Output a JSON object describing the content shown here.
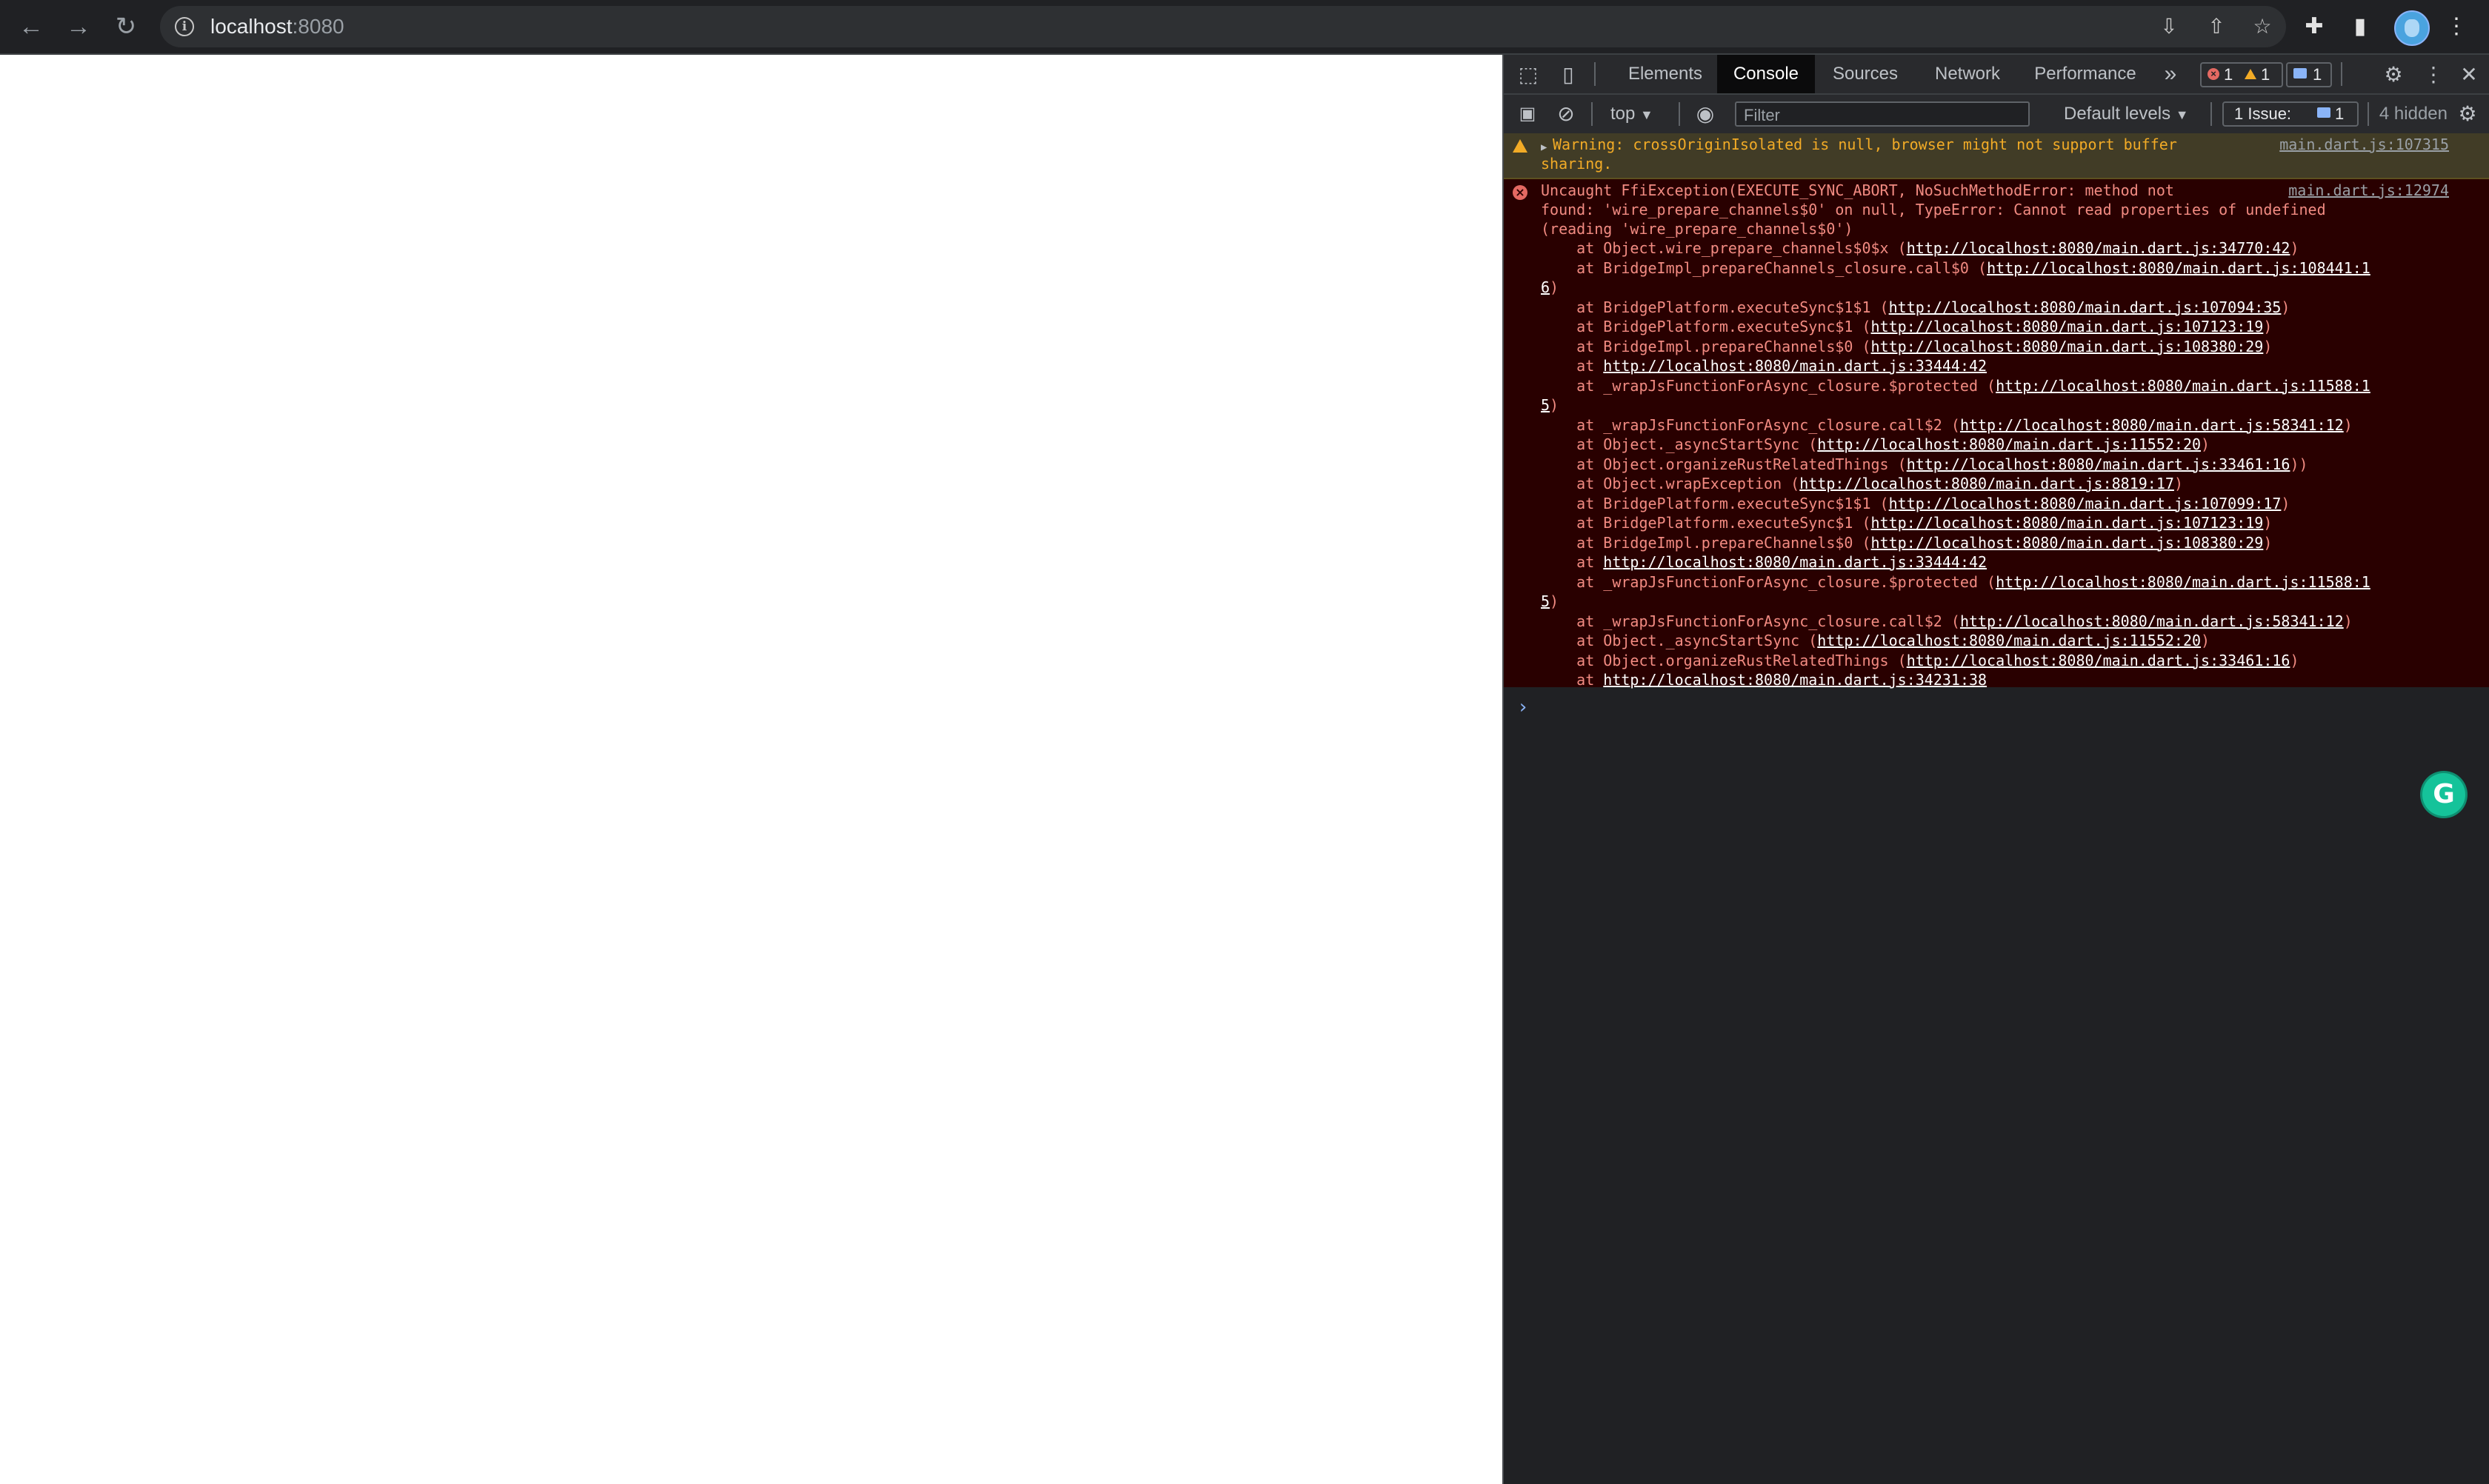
{
  "browser": {
    "url_host": "localhost",
    "url_port": ":8080"
  },
  "devtools": {
    "tabs": [
      "Elements",
      "Console",
      "Sources",
      "Network",
      "Performance"
    ],
    "active_tab": "Console",
    "more_tabs": "»",
    "errors_count": "1",
    "warnings_count": "1",
    "messages_count": "1",
    "context": "top",
    "filter_placeholder": "Filter",
    "levels": "Default levels",
    "issues_label": "1 Issue:",
    "issues_count": "1",
    "hidden": "4 hidden"
  },
  "console": {
    "warning": {
      "line1": "Warning: crossOriginIsolated is null, browser might not support buffer",
      "line2": "sharing.",
      "source": "main.dart.js:107315"
    },
    "error": {
      "line1": "Uncaught FfiException(EXECUTE_SYNC_ABORT, NoSuchMethodError: method not",
      "line2": "found: 'wire_prepare_channels$0' on null, TypeError: Cannot read properties of undefined",
      "line3": "(reading 'wire_prepare_channels$0')",
      "source": "main.dart.js:12974",
      "stack": [
        {
          "pre": "    at Object.wire_prepare_channels$0$x (",
          "link": "http://localhost:8080/main.dart.js:34770:42",
          "post": ")"
        },
        {
          "pre": "    at BridgeImpl_prepareChannels_closure.call$0 (",
          "link": "http://localhost:8080/main.dart.js:108441:1",
          "post": ""
        },
        {
          "pre": "",
          "link": "6",
          "post": ")"
        },
        {
          "pre": "    at BridgePlatform.executeSync$1$1 (",
          "link": "http://localhost:8080/main.dart.js:107094:35",
          "post": ")"
        },
        {
          "pre": "    at BridgePlatform.executeSync$1 (",
          "link": "http://localhost:8080/main.dart.js:107123:19",
          "post": ")"
        },
        {
          "pre": "    at BridgeImpl.prepareChannels$0 (",
          "link": "http://localhost:8080/main.dart.js:108380:29",
          "post": ")"
        },
        {
          "pre": "    at ",
          "link": "http://localhost:8080/main.dart.js:33444:42",
          "post": ""
        },
        {
          "pre": "    at _wrapJsFunctionForAsync_closure.$protected (",
          "link": "http://localhost:8080/main.dart.js:11588:1",
          "post": ""
        },
        {
          "pre": "",
          "link": "5",
          "post": ")"
        },
        {
          "pre": "    at _wrapJsFunctionForAsync_closure.call$2 (",
          "link": "http://localhost:8080/main.dart.js:58341:12",
          "post": ")"
        },
        {
          "pre": "    at Object._asyncStartSync (",
          "link": "http://localhost:8080/main.dart.js:11552:20",
          "post": ")"
        },
        {
          "pre": "    at Object.organizeRustRelatedThings (",
          "link": "http://localhost:8080/main.dart.js:33461:16",
          "post": "))"
        },
        {
          "pre": "    at Object.wrapException (",
          "link": "http://localhost:8080/main.dart.js:8819:17",
          "post": ")"
        },
        {
          "pre": "    at BridgePlatform.executeSync$1$1 (",
          "link": "http://localhost:8080/main.dart.js:107099:17",
          "post": ")"
        },
        {
          "pre": "    at BridgePlatform.executeSync$1 (",
          "link": "http://localhost:8080/main.dart.js:107123:19",
          "post": ")"
        },
        {
          "pre": "    at BridgeImpl.prepareChannels$0 (",
          "link": "http://localhost:8080/main.dart.js:108380:29",
          "post": ")"
        },
        {
          "pre": "    at ",
          "link": "http://localhost:8080/main.dart.js:33444:42",
          "post": ""
        },
        {
          "pre": "    at _wrapJsFunctionForAsync_closure.$protected (",
          "link": "http://localhost:8080/main.dart.js:11588:1",
          "post": ""
        },
        {
          "pre": "",
          "link": "5",
          "post": ")"
        },
        {
          "pre": "    at _wrapJsFunctionForAsync_closure.call$2 (",
          "link": "http://localhost:8080/main.dart.js:58341:12",
          "post": ")"
        },
        {
          "pre": "    at Object._asyncStartSync (",
          "link": "http://localhost:8080/main.dart.js:11552:20",
          "post": ")"
        },
        {
          "pre": "    at Object.organizeRustRelatedThings (",
          "link": "http://localhost:8080/main.dart.js:33461:16",
          "post": ")"
        },
        {
          "pre": "    at ",
          "link": "http://localhost:8080/main.dart.js:34231:38",
          "post": ""
        }
      ]
    },
    "prompt": "›"
  },
  "icons": [
    "back-arrow-icon",
    "forward-arrow-icon",
    "reload-icon",
    "info-icon",
    "install-icon",
    "share-icon",
    "bookmark-star-icon",
    "extensions-icon",
    "side-panel-icon",
    "profile-avatar",
    "menu-kebab-icon",
    "inspect-element-icon",
    "device-toggle-icon",
    "settings-gear-icon",
    "close-icon",
    "sidebar-toggle-icon",
    "clear-console-icon",
    "eye-icon",
    "grammarly-icon"
  ]
}
